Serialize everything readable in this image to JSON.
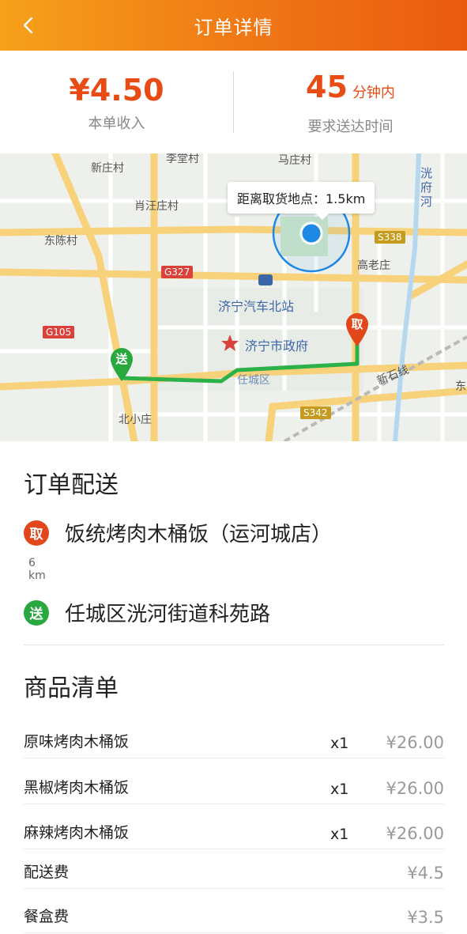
{
  "header": {
    "title": "订单详情",
    "back_icon": "chevron-left-icon"
  },
  "stats": {
    "income": {
      "value": "¥4.50",
      "label": "本单收入"
    },
    "time": {
      "value": "45",
      "unit": "分钟内",
      "label": "要求送达时间"
    }
  },
  "map": {
    "tooltip": "距离取货地点：1.5km",
    "labels": [
      "新庄村",
      "李堂村",
      "马庄村",
      "肖汪庄村",
      "东陈村",
      "高老庄",
      "济宁汽车北站",
      "济宁市政府",
      "北小庄",
      "任城区",
      "洸府河",
      "新石线",
      "东"
    ],
    "roads": [
      "S338",
      "G327",
      "G105",
      "S342"
    ],
    "pickup_pin": "取",
    "deliver_pin": "送"
  },
  "delivery": {
    "title": "订单配送",
    "pickup_badge": "取",
    "pickup_address": "饭统烤肉木桶饭（运河城店）",
    "distance_value": "6",
    "distance_unit": "km",
    "deliver_badge": "送",
    "deliver_address": "任城区洸河街道科苑路"
  },
  "goods": {
    "title": "商品清单",
    "items": [
      {
        "name": "原味烤肉木桶饭",
        "qty": "x1",
        "price": "¥26.00"
      },
      {
        "name": "黑椒烤肉木桶饭",
        "qty": "x1",
        "price": "¥26.00"
      },
      {
        "name": "麻辣烤肉木桶饭",
        "qty": "x1",
        "price": "¥26.00"
      }
    ],
    "fees": [
      {
        "name": "配送费",
        "price": "¥4.5"
      },
      {
        "name": "餐盒费",
        "price": "¥3.5"
      }
    ]
  },
  "colors": {
    "accent": "#e84c14",
    "header_start": "#f6a11a",
    "header_end": "#ea5a10",
    "pickup": "#e2461b",
    "deliver": "#29a83f",
    "route": "#2bb04a",
    "location": "#1e88e5"
  }
}
